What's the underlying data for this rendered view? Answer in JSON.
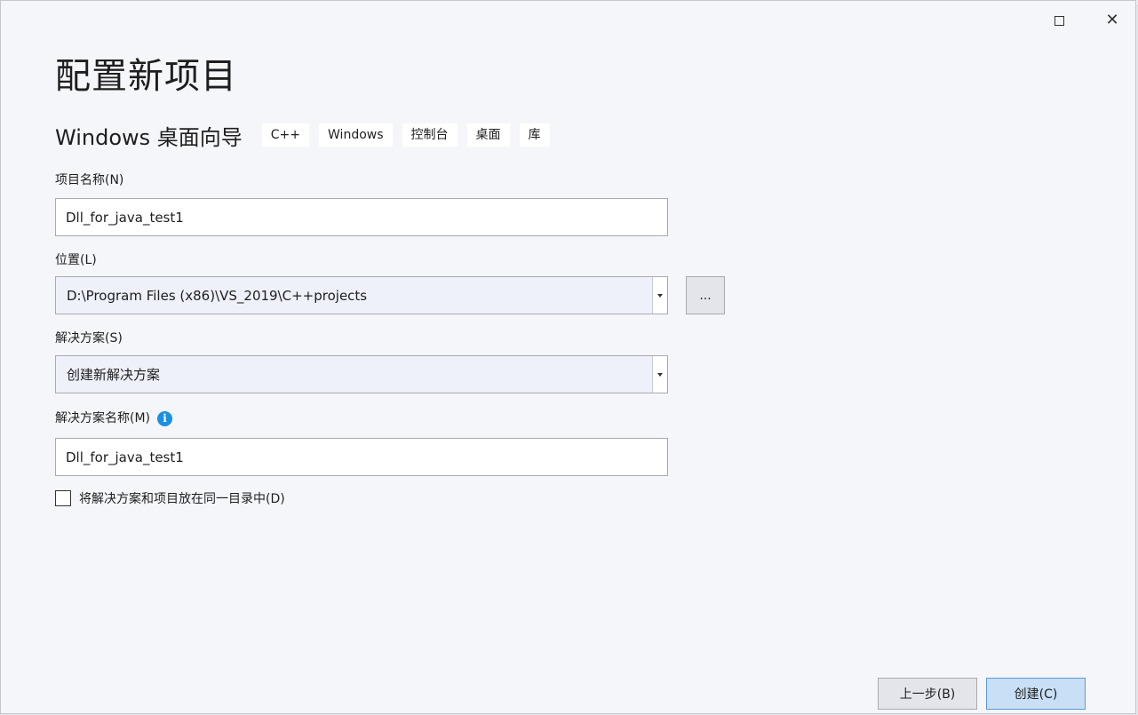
{
  "window": {
    "maximize_icon": "maximize-icon",
    "close_icon": "close-icon",
    "close_glyph": "✕"
  },
  "page": {
    "title": "配置新项目"
  },
  "template": {
    "name": "Windows 桌面向导",
    "tags": [
      "C++",
      "Windows",
      "控制台",
      "桌面",
      "库"
    ]
  },
  "fields": {
    "project_name": {
      "label": "项目名称(N)",
      "value": "Dll_for_java_test1"
    },
    "location": {
      "label": "位置(L)",
      "value": "D:\\Program Files (x86)\\VS_2019\\C++projects",
      "browse_label": "..."
    },
    "solution": {
      "label": "解决方案(S)",
      "value": "创建新解决方案"
    },
    "solution_name": {
      "label": "解决方案名称(M)",
      "info_icon": "info-icon",
      "info_glyph": "i",
      "value": "Dll_for_java_test1"
    },
    "same_directory": {
      "label": "将解决方案和项目放在同一目录中(D)",
      "checked": false
    }
  },
  "footer": {
    "back_label": "上一步(B)",
    "create_label": "创建(C)"
  },
  "colors": {
    "background": "#f5f6fa",
    "primary_button": "#c9dff5",
    "primary_border": "#5b9bd5",
    "info": "#1b8fe0"
  }
}
